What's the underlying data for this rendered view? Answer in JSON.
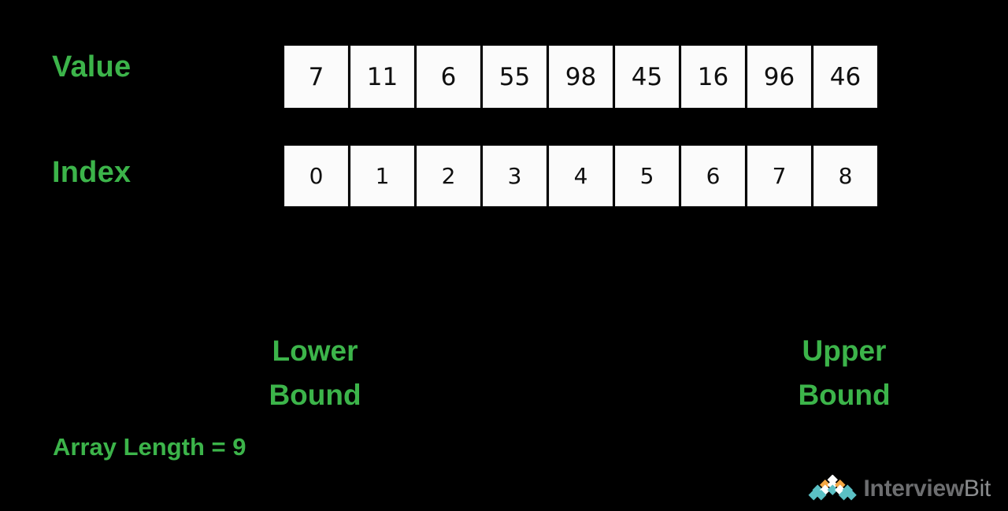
{
  "canvas": {
    "background": "#000000",
    "accent_green": "#3CB44A",
    "cell_fill": "#FBFBFB",
    "cell_text": "#101010"
  },
  "rows": {
    "value": {
      "label": "Value",
      "cells": [
        "7",
        "11",
        "6",
        "55",
        "98",
        "45",
        "16",
        "96",
        "46"
      ]
    },
    "index": {
      "label": "Index",
      "cells": [
        "0",
        "1",
        "2",
        "3",
        "4",
        "5",
        "6",
        "7",
        "8"
      ]
    }
  },
  "annotations": {
    "lower_bound": "Lower\nBound",
    "upper_bound": "Upper\nBound",
    "array_length": "Array Length = 9"
  },
  "watermark": {
    "primary_text": "Interview",
    "secondary_text": "Bit",
    "mark_colors": {
      "teal": "#5BC0C4",
      "orange": "#F5A742",
      "white": "#FFFFFF"
    }
  }
}
